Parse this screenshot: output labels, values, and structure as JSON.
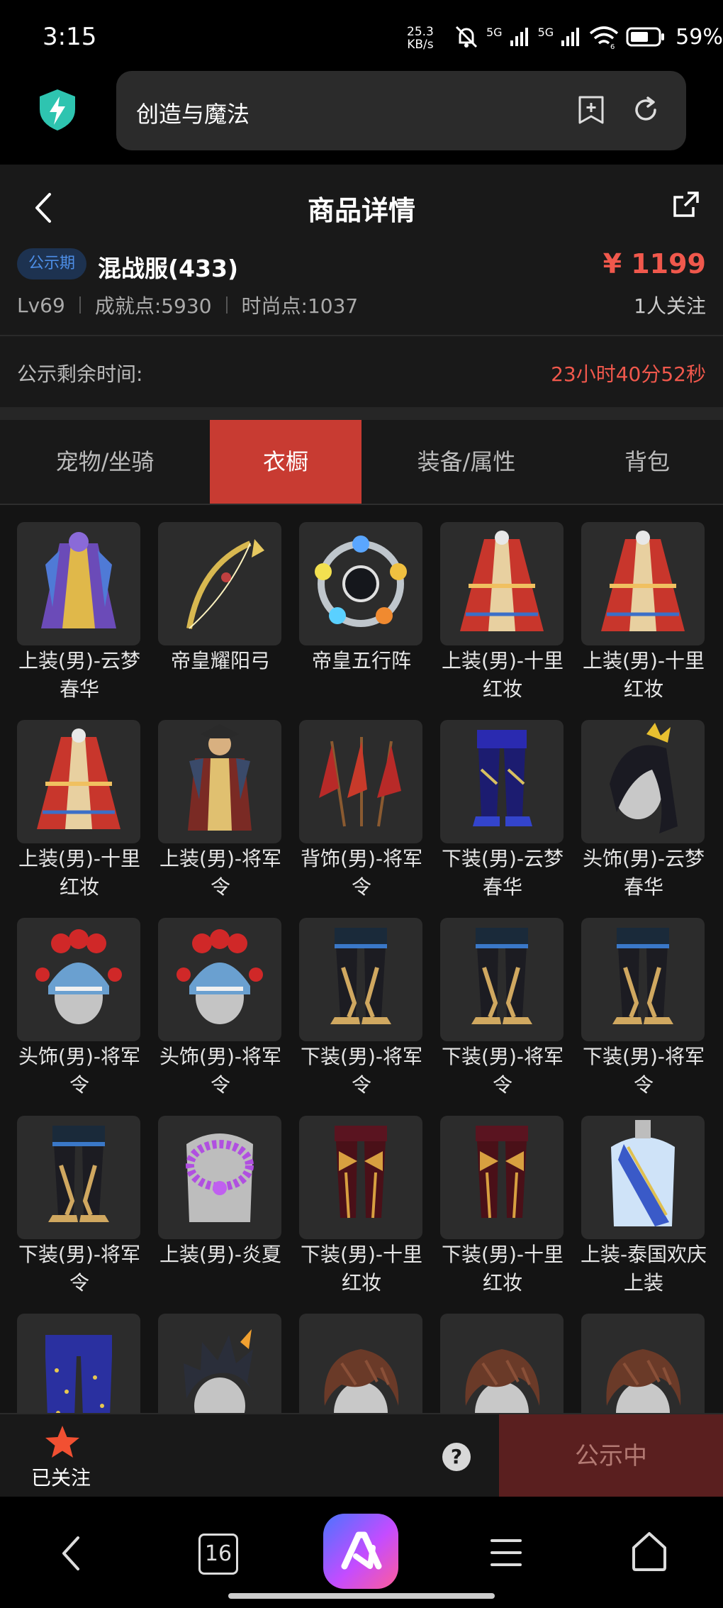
{
  "status_bar": {
    "time": "3:15",
    "net_speed_value": "25.3",
    "net_speed_unit": "KB/s",
    "net1": "5G",
    "net2": "5G",
    "wifi_sub": "6",
    "battery": "59%"
  },
  "browser": {
    "url_text": "创造与魔法",
    "icons": [
      "shield-icon",
      "bookmark-add-icon",
      "refresh-icon"
    ]
  },
  "header": {
    "title": "商品详情",
    "icons": [
      "back-arrow-icon",
      "share-icon"
    ]
  },
  "item": {
    "badge": "公示期",
    "name": "混战服(433)",
    "price": "¥ 1199",
    "level": "Lv69",
    "achievement": "成就点:5930",
    "fashion": "时尚点:1037",
    "followers": "1人关注"
  },
  "notice": {
    "label": "公示剩余时间:",
    "countdown": "23小时40分52秒"
  },
  "tabs": [
    {
      "label": "宠物/坐骑"
    },
    {
      "label": "衣橱"
    },
    {
      "label": "装备/属性"
    },
    {
      "label": "背包"
    }
  ],
  "active_tab": "衣橱",
  "wardrobe": [
    {
      "label": "上装(男)-云梦春华",
      "icon": "robe-purple"
    },
    {
      "label": "帝皇耀阳弓",
      "icon": "bow"
    },
    {
      "label": "帝皇五行阵",
      "icon": "orb-ring"
    },
    {
      "label": "上装(男)-十里红妆",
      "icon": "robe-red"
    },
    {
      "label": "上装(男)-十里红妆",
      "icon": "robe-red"
    },
    {
      "label": "上装(男)-十里红妆",
      "icon": "robe-red"
    },
    {
      "label": "上装(男)-将军令",
      "icon": "armor-general"
    },
    {
      "label": "背饰(男)-将军令",
      "icon": "flags"
    },
    {
      "label": "下装(男)-云梦春华",
      "icon": "pants-blue"
    },
    {
      "label": "头饰(男)-云梦春华",
      "icon": "head-hair"
    },
    {
      "label": "头饰(男)-将军令",
      "icon": "head-opera"
    },
    {
      "label": "头饰(男)-将军令",
      "icon": "head-opera"
    },
    {
      "label": "下装(男)-将军令",
      "icon": "pants-dark"
    },
    {
      "label": "下装(男)-将军令",
      "icon": "pants-dark"
    },
    {
      "label": "下装(男)-将军令",
      "icon": "pants-dark"
    },
    {
      "label": "下装(男)-将军令",
      "icon": "pants-dark"
    },
    {
      "label": "上装(男)-炎夏",
      "icon": "torso-lei"
    },
    {
      "label": "下装(男)-十里红妆",
      "icon": "pants-red"
    },
    {
      "label": "下装(男)-十里红妆",
      "icon": "pants-red"
    },
    {
      "label": "上装-泰国欢庆上装",
      "icon": "torso-thai"
    },
    {
      "label": "",
      "icon": "pants-starry"
    },
    {
      "label": "",
      "icon": "head-spiky"
    },
    {
      "label": "",
      "icon": "head-brown"
    },
    {
      "label": "",
      "icon": "head-brown"
    },
    {
      "label": "",
      "icon": "head-brown"
    }
  ],
  "action_bar": {
    "followed_label": "已关注",
    "help": "?",
    "cta_label": "公示中"
  },
  "system_nav": {
    "tabs_count": "16"
  },
  "colors": {
    "accent": "#c83b32",
    "price": "#f0584c",
    "badge_bg": "#1d3250",
    "badge_text": "#4d8ee6"
  }
}
